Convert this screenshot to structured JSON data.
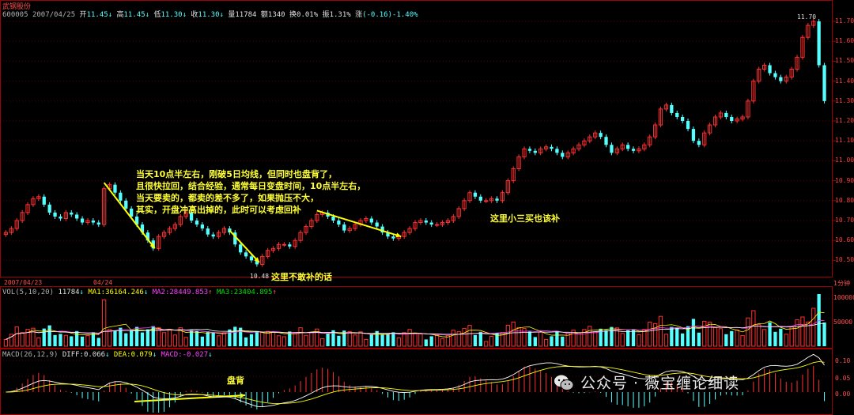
{
  "header": {
    "stock_name": "武钢股份",
    "code": "600005",
    "date": "2007/04/25",
    "open_label": "开",
    "open": "11.45",
    "high_label": "高",
    "high": "11.45",
    "low_label": "低",
    "low": "11.30",
    "close_label": "收",
    "close": "11.30",
    "volume_label": "量",
    "volume": "11784",
    "amount_label": "额",
    "amount": "1340",
    "turnover_label": "换",
    "turnover": "0.01%",
    "amplitude_label": "振",
    "amplitude": "1.31%",
    "change_label": "涨",
    "change": "(-0.16)-1.40%"
  },
  "price_axis": [
    "11.70",
    "11.60",
    "11.50",
    "11.40",
    "11.30",
    "11.20",
    "11.10",
    "11.00",
    "10.90",
    "10.80",
    "10.70",
    "10.60",
    "10.50"
  ],
  "price_marks": {
    "high": "11.70",
    "low": "10.48"
  },
  "date_bar": {
    "left": "2007/04/23",
    "mid": "04/24",
    "period": "1分钟"
  },
  "volume_panel": {
    "title": "VOL(5,10,20)",
    "vol": "11784",
    "ma1_label": "MA1:",
    "ma1": "36164.246",
    "ma2_label": "MA2:",
    "ma2": "28449.853",
    "ma3_label": "MA3:",
    "ma3": "23404.895",
    "axis": [
      "100000",
      "50000"
    ]
  },
  "macd_panel": {
    "title": "MACD(26,12,9)",
    "diff_label": "DIFF:",
    "diff": "0.066",
    "dea_label": "DEA:",
    "dea": "0.079",
    "macd_label": "MACD:",
    "macd": "-0.027",
    "axis": [
      "0.10",
      "0.05",
      "0.00"
    ]
  },
  "annotations": {
    "main_note": [
      "当天10点半左右，刚破5日均线，但同时也盘背了，",
      "且很快拉回，结合经验，通常每日变盘时间，10点半左右，",
      "当天要卖的，都卖的差不多了，如果抛压不大，",
      "其实，开盘冲高出掉的，此时可以考虑回补"
    ],
    "low_note": "这里不敢补的话",
    "mid_note": "这里小三买也该补",
    "macd_note": "盘背"
  },
  "watermark": "公众号 · 薇宝缠论细读",
  "colors": {
    "up": "#ff3030",
    "down": "#54ffff",
    "frame": "#a00000",
    "ma_yellow": "#ffff00",
    "ma_white": "#ffffff",
    "ma_mag": "#ff40ff"
  },
  "chart_data": {
    "type": "candlestick",
    "interval_label": "1分钟",
    "price_range": [
      10.45,
      11.72
    ],
    "price_ticks": [
      10.5,
      10.6,
      10.7,
      10.8,
      10.9,
      11.0,
      11.1,
      11.2,
      11.3,
      11.4,
      11.5,
      11.6,
      11.7
    ],
    "candles_close": [
      10.64,
      10.66,
      10.7,
      10.74,
      10.78,
      10.81,
      10.82,
      10.78,
      10.74,
      10.72,
      10.71,
      10.74,
      10.73,
      10.71,
      10.69,
      10.7,
      10.69,
      10.68,
      10.86,
      10.88,
      10.84,
      10.8,
      10.76,
      10.72,
      10.68,
      10.64,
      10.6,
      10.56,
      10.62,
      10.64,
      10.66,
      10.68,
      10.72,
      10.74,
      10.7,
      10.68,
      10.66,
      10.63,
      10.62,
      10.64,
      10.66,
      10.64,
      10.58,
      10.54,
      10.52,
      10.5,
      10.48,
      10.52,
      10.55,
      10.56,
      10.58,
      10.58,
      10.57,
      10.6,
      10.64,
      10.67,
      10.7,
      10.73,
      10.74,
      10.72,
      10.7,
      10.68,
      10.65,
      10.66,
      10.68,
      10.7,
      10.71,
      10.69,
      10.67,
      10.64,
      10.62,
      10.61,
      10.62,
      10.64,
      10.66,
      10.69,
      10.7,
      10.69,
      10.68,
      10.68,
      10.69,
      10.7,
      10.72,
      10.76,
      10.8,
      10.84,
      10.82,
      10.8,
      10.8,
      10.81,
      10.8,
      10.84,
      10.9,
      10.96,
      11.02,
      11.06,
      11.05,
      11.04,
      11.06,
      11.07,
      11.06,
      11.04,
      11.02,
      11.04,
      11.06,
      11.08,
      11.1,
      11.12,
      11.14,
      11.12,
      11.08,
      11.04,
      11.06,
      11.08,
      11.06,
      11.05,
      11.06,
      11.08,
      11.12,
      11.18,
      11.26,
      11.28,
      11.24,
      11.22,
      11.2,
      11.16,
      11.1,
      11.08,
      11.14,
      11.18,
      11.22,
      11.24,
      11.22,
      11.2,
      11.21,
      11.22,
      11.3,
      11.4,
      11.46,
      11.48,
      11.44,
      11.42,
      11.4,
      11.42,
      11.46,
      11.52,
      11.62,
      11.68,
      11.7,
      11.48,
      11.3
    ],
    "volume_axis": [
      100000,
      50000
    ],
    "macd_axis": [
      0.1,
      0.05,
      0.0
    ],
    "dates": [
      "2007/04/23",
      "04/24"
    ]
  }
}
